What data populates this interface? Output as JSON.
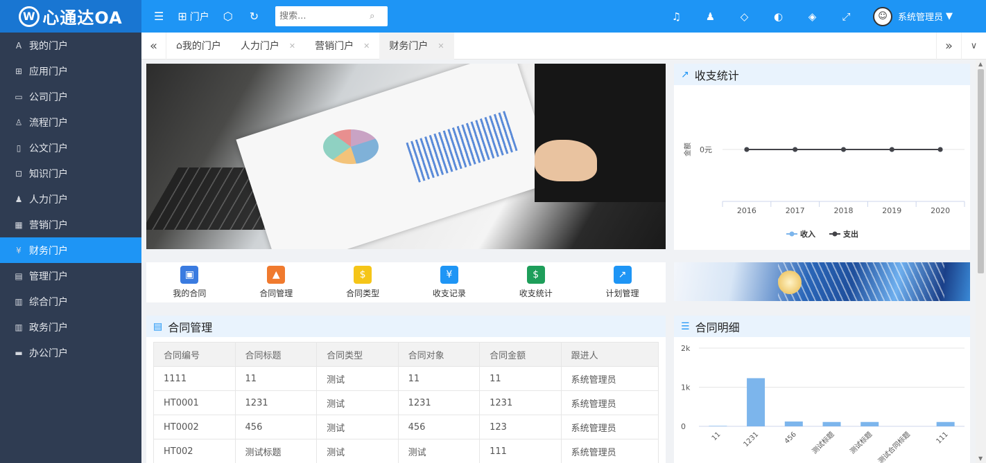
{
  "app": {
    "logo_text": "心通达OA",
    "logo_mark": "W"
  },
  "topbar": {
    "portal_label": "门户",
    "search_placeholder": "搜索...",
    "user_name": "系统管理员"
  },
  "sidebar": {
    "items": [
      {
        "label": "我的门户",
        "icon": "person-icon",
        "glyph": "A",
        "active": false
      },
      {
        "label": "应用门户",
        "icon": "apps-icon",
        "glyph": "⊞",
        "active": false
      },
      {
        "label": "公司门户",
        "icon": "building-icon",
        "glyph": "▭",
        "active": false
      },
      {
        "label": "流程门户",
        "icon": "flow-icon",
        "glyph": "♙",
        "active": false
      },
      {
        "label": "公文门户",
        "icon": "document-icon",
        "glyph": "▯",
        "active": false
      },
      {
        "label": "知识门户",
        "icon": "book-icon",
        "glyph": "⊡",
        "active": false
      },
      {
        "label": "人力门户",
        "icon": "users-icon",
        "glyph": "♟",
        "active": false
      },
      {
        "label": "营销门户",
        "icon": "calendar-icon",
        "glyph": "▦",
        "active": false
      },
      {
        "label": "财务门户",
        "icon": "yen-icon",
        "glyph": "¥",
        "active": true
      },
      {
        "label": "管理门户",
        "icon": "grid-icon",
        "glyph": "▤",
        "active": false
      },
      {
        "label": "综合门户",
        "icon": "column-icon",
        "glyph": "▥",
        "active": false
      },
      {
        "label": "政务门户",
        "icon": "column-icon",
        "glyph": "▥",
        "active": false
      },
      {
        "label": "办公门户",
        "icon": "window-icon",
        "glyph": "▬",
        "active": false
      }
    ]
  },
  "tabs": [
    {
      "label": "我的门户",
      "closable": false,
      "active": false
    },
    {
      "label": "人力门户",
      "closable": true,
      "active": false
    },
    {
      "label": "营销门户",
      "closable": true,
      "active": false
    },
    {
      "label": "财务门户",
      "closable": true,
      "active": true
    }
  ],
  "quick_links": [
    {
      "label": "我的合同",
      "icon": "contract-icon",
      "color": "#3a7be0",
      "glyph": "▣"
    },
    {
      "label": "合同管理",
      "icon": "presentation-icon",
      "color": "#f07a2e",
      "glyph": "▲"
    },
    {
      "label": "合同类型",
      "icon": "money-hand-icon",
      "color": "#f5c518",
      "glyph": "$"
    },
    {
      "label": "收支记录",
      "icon": "yen-chart-icon",
      "color": "#1e95f5",
      "glyph": "¥"
    },
    {
      "label": "收支统计",
      "icon": "money-bag-icon",
      "color": "#1e9e5a",
      "glyph": "$"
    },
    {
      "label": "计划管理",
      "icon": "growth-chart-icon",
      "color": "#1e95f5",
      "glyph": "↗"
    }
  ],
  "stats_panel": {
    "title": "收支统计"
  },
  "contract_panel": {
    "title": "合同管理",
    "columns": [
      "合同编号",
      "合同标题",
      "合同类型",
      "合同对象",
      "合同金额",
      "跟进人"
    ],
    "rows": [
      [
        "1111",
        "11",
        "测试",
        "11",
        "11",
        "系统管理员"
      ],
      [
        "HT0001",
        "1231",
        "测试",
        "1231",
        "1231",
        "系统管理员"
      ],
      [
        "HT0002",
        "456",
        "测试",
        "456",
        "123",
        "系统管理员"
      ],
      [
        "HT002",
        "测试标题",
        "测试",
        "测试",
        "111",
        "系统管理员"
      ]
    ]
  },
  "detail_panel": {
    "title": "合同明细"
  },
  "chart_data": [
    {
      "type": "line",
      "categories": [
        "2016",
        "2017",
        "2018",
        "2019",
        "2020"
      ],
      "series": [
        {
          "name": "收入",
          "values": [
            0,
            0,
            0,
            0,
            0
          ],
          "color": "#7cb5ec"
        },
        {
          "name": "支出",
          "values": [
            0,
            0,
            0,
            0,
            0
          ],
          "color": "#434348"
        }
      ],
      "ylabel": "金额",
      "y_tick_labels": [
        "0元"
      ],
      "legend": "bottom"
    },
    {
      "type": "bar",
      "categories": [
        "11",
        "1231",
        "456",
        "测试标题",
        "测试标题",
        "测试合同标题",
        "111"
      ],
      "values": [
        11,
        1231,
        123,
        111,
        111,
        0,
        111
      ],
      "color": "#7cb5ec",
      "y_tick_labels": [
        "2k",
        "1k",
        "0"
      ],
      "ylim": [
        0,
        2000
      ],
      "grid": true
    }
  ]
}
